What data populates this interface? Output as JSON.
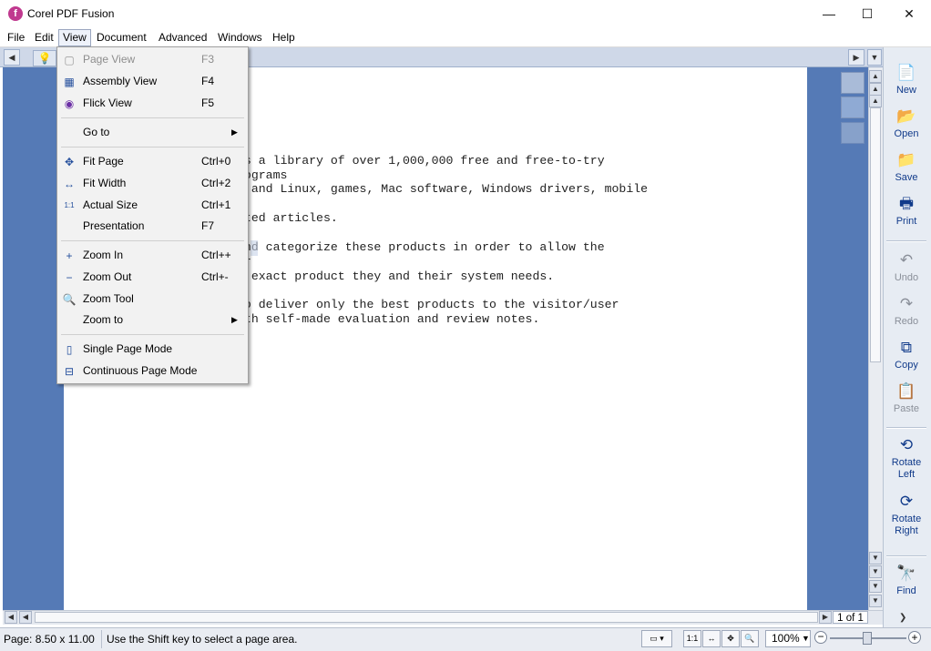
{
  "window": {
    "title": "Corel PDF Fusion",
    "minimize": "—",
    "maximize": "☐",
    "close": "✕"
  },
  "menubar": [
    "File",
    "Edit",
    "View",
    "Document",
    "Advanced",
    "Windows",
    "Help"
  ],
  "view_menu": [
    {
      "label": "Page View",
      "shortcut": "F3",
      "icon": "page-view-icon",
      "disabled": true
    },
    {
      "label": "Assembly View",
      "shortcut": "F4",
      "icon": "assembly-view-icon"
    },
    {
      "label": "Flick View",
      "shortcut": "F5",
      "icon": "flick-view-icon"
    },
    {
      "label": "Go to",
      "shortcut": "",
      "submenu": true
    },
    {
      "label": "Fit Page",
      "shortcut": "Ctrl+0",
      "icon": "fit-page-icon"
    },
    {
      "label": "Fit Width",
      "shortcut": "Ctrl+2",
      "icon": "fit-width-icon"
    },
    {
      "label": "Actual Size",
      "shortcut": "Ctrl+1",
      "icon": "actual-size-icon"
    },
    {
      "label": "Presentation",
      "shortcut": "F7"
    },
    {
      "label": "Zoom In",
      "shortcut": "Ctrl++",
      "icon": "plus-icon"
    },
    {
      "label": "Zoom Out",
      "shortcut": "Ctrl+-",
      "icon": "minus-icon"
    },
    {
      "label": "Zoom Tool",
      "shortcut": "",
      "icon": "magnifier-icon"
    },
    {
      "label": "Zoom to",
      "shortcut": "",
      "submenu": true
    },
    {
      "label": "Single Page Mode",
      "shortcut": "",
      "icon": "single-page-icon"
    },
    {
      "label": "Continuous Page Mode",
      "shortcut": "",
      "icon": "continuous-page-icon"
    }
  ],
  "document_lines": [
    "is a library of over 1,000,000 free and free-to-try",
    "rograms",
    "s and Linux, games, Mac software, Windows drivers, mobile",
    "",
    "ated articles.",
    "",
    "and categorize these products in order to allow the",
    "er",
    "e exact product they and their system needs.",
    "",
    "to deliver only the best products to the visitor/user",
    "ith self-made evaluation and review notes."
  ],
  "right_panel": [
    {
      "label": "New",
      "icon": "new-document-icon",
      "disabled": false
    },
    {
      "label": "Open",
      "icon": "open-folder-icon",
      "disabled": false
    },
    {
      "label": "Save",
      "icon": "save-icon",
      "disabled": false
    },
    {
      "label": "Print",
      "icon": "printer-icon",
      "disabled": false
    },
    {
      "label": "Undo",
      "icon": "undo-icon",
      "disabled": true
    },
    {
      "label": "Redo",
      "icon": "redo-icon",
      "disabled": true
    },
    {
      "label": "Copy",
      "icon": "copy-icon",
      "disabled": false
    },
    {
      "label": "Paste",
      "icon": "paste-icon",
      "disabled": true
    },
    {
      "label": "Rotate Left",
      "icon": "rotate-left-icon",
      "disabled": false
    },
    {
      "label": "Rotate Right",
      "icon": "rotate-right-icon",
      "disabled": false
    },
    {
      "label": "Find",
      "icon": "binoculars-icon",
      "disabled": false
    }
  ],
  "status": {
    "page_size": "Page: 8.50 x 11.00 in",
    "hint": "Use the Shift key to select a page area.",
    "zoom": "100%",
    "page_indicator": "1 of 1"
  },
  "colors": {
    "workspace": "#557ab6",
    "accent": "#103a8a"
  }
}
